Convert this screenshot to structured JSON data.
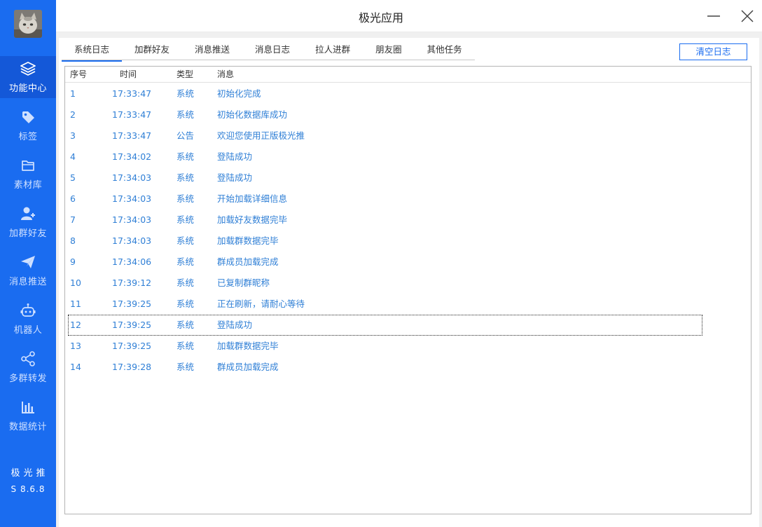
{
  "window": {
    "title": "极光应用"
  },
  "sidebar": {
    "items": [
      {
        "label": "功能中心",
        "icon": "layers-icon",
        "active": true
      },
      {
        "label": "标签",
        "icon": "tag-icon"
      },
      {
        "label": "素材库",
        "icon": "folder-icon"
      },
      {
        "label": "加群好友",
        "icon": "add-user-icon"
      },
      {
        "label": "消息推送",
        "icon": "paper-plane-icon"
      },
      {
        "label": "机器人",
        "icon": "robot-icon"
      },
      {
        "label": "多群转发",
        "icon": "share-icon"
      },
      {
        "label": "数据统计",
        "icon": "bar-chart-icon"
      }
    ],
    "brand_name": "极光推",
    "version": "S 8.6.8"
  },
  "tabs": [
    {
      "label": "系统日志",
      "active": true
    },
    {
      "label": "加群好友"
    },
    {
      "label": "消息推送"
    },
    {
      "label": "消息日志"
    },
    {
      "label": "拉人进群"
    },
    {
      "label": "朋友圈"
    },
    {
      "label": "其他任务"
    }
  ],
  "toolbar": {
    "clear_label": "清空日志"
  },
  "log": {
    "columns": [
      "序号",
      "时间",
      "类型",
      "消息"
    ],
    "selected_row": "12",
    "rows": [
      {
        "no": "1",
        "time": "17:33:47",
        "type": "系统",
        "msg": "初始化完成"
      },
      {
        "no": "2",
        "time": "17:33:47",
        "type": "系统",
        "msg": "初始化数据库成功"
      },
      {
        "no": "3",
        "time": "17:33:47",
        "type": "公告",
        "msg": "欢迎您使用正版极光推"
      },
      {
        "no": "4",
        "time": "17:34:02",
        "type": "系统",
        "msg": "登陆成功"
      },
      {
        "no": "5",
        "time": "17:34:03",
        "type": "系统",
        "msg": "登陆成功"
      },
      {
        "no": "6",
        "time": "17:34:03",
        "type": "系统",
        "msg": "开始加载详细信息"
      },
      {
        "no": "7",
        "time": "17:34:03",
        "type": "系统",
        "msg": "加载好友数据完毕"
      },
      {
        "no": "8",
        "time": "17:34:03",
        "type": "系统",
        "msg": "加载群数据完毕"
      },
      {
        "no": "9",
        "time": "17:34:06",
        "type": "系统",
        "msg": "群成员加载完成"
      },
      {
        "no": "10",
        "time": "17:39:12",
        "type": "系统",
        "msg": "已复制群昵称"
      },
      {
        "no": "11",
        "time": "17:39:25",
        "type": "系统",
        "msg": "正在刷新，请耐心等待"
      },
      {
        "no": "12",
        "time": "17:39:25",
        "type": "系统",
        "msg": "登陆成功"
      },
      {
        "no": "13",
        "time": "17:39:25",
        "type": "系统",
        "msg": "加载群数据完毕"
      },
      {
        "no": "14",
        "time": "17:39:28",
        "type": "系统",
        "msg": "群成员加载完成"
      }
    ]
  },
  "colors": {
    "sidebar": "#1a6cf0",
    "sidebar_active": "#1458d8",
    "accent": "#1a6cf0",
    "log_text": "#2f7fd6"
  }
}
